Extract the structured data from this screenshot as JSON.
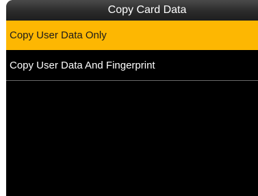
{
  "window": {
    "title": "Copy Card Data"
  },
  "menu": {
    "items": [
      {
        "label": "Copy User Data Only",
        "selected": true
      },
      {
        "label": "Copy User Data And Fingerprint",
        "selected": false
      }
    ]
  },
  "colors": {
    "highlight": "#fdb702",
    "background": "#000000",
    "title_bar": "#2b2b2b",
    "text": "#ffffff"
  }
}
